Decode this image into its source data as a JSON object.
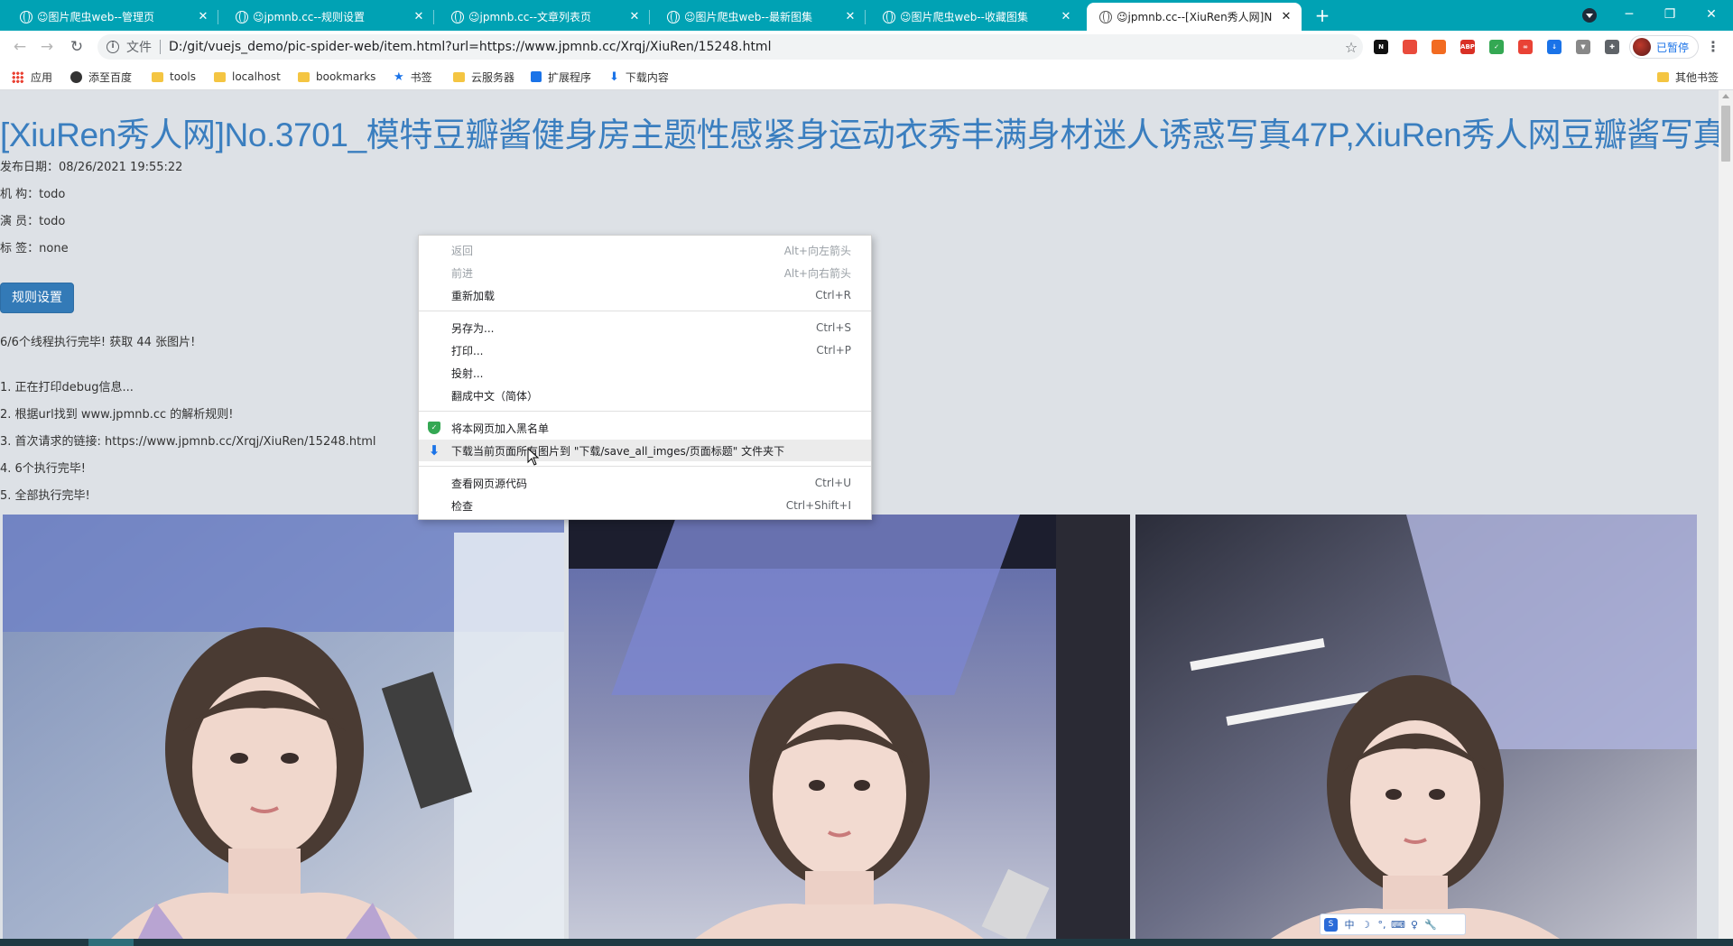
{
  "browser": {
    "tabs": [
      {
        "title": "😉图片爬虫web--管理页",
        "active": false
      },
      {
        "title": "😉jpmnb.cc--规则设置",
        "active": false
      },
      {
        "title": "😉jpmnb.cc--文章列表页",
        "active": false
      },
      {
        "title": "😉图片爬虫web--最新图集",
        "active": false
      },
      {
        "title": "😉图片爬虫web--收藏图集",
        "active": false
      },
      {
        "title": "😉jpmnb.cc--[XiuRen秀人网]N",
        "active": true
      }
    ],
    "new_tab_label": "+",
    "window_controls": {
      "minimize": "─",
      "restore": "❐",
      "close": "✕"
    },
    "address": {
      "security_label": "文件",
      "url": "D:/git/vuejs_demo/pic-spider-web/item.html?url=https://www.jpmnb.cc/Xrqj/XiuRen/15248.html"
    },
    "profile_label": "已暂停",
    "extensions": [
      {
        "name": "notion-icon",
        "color": "#111111",
        "text": "N"
      },
      {
        "name": "screenshot-icon",
        "color": "#e94b3c",
        "text": ""
      },
      {
        "name": "ext-orange-icon",
        "color": "#f26b21",
        "text": ""
      },
      {
        "name": "adblock-icon",
        "color": "#d93025",
        "text": "ABP"
      },
      {
        "name": "shield-ext-icon",
        "color": "#34a853",
        "text": "✓"
      },
      {
        "name": "ext-red-icon",
        "color": "#e94235",
        "text": "∞"
      },
      {
        "name": "download-ext-icon",
        "color": "#1a73e8",
        "text": "↓"
      },
      {
        "name": "ext-gray-icon",
        "color": "#888888",
        "text": "▼"
      },
      {
        "name": "extensions-puzzle-icon",
        "color": "#5f6368",
        "text": "✚"
      }
    ],
    "bookmarks": [
      {
        "label": "应用",
        "icon": "apps-grid-icon"
      },
      {
        "label": "添至百度",
        "icon": "globe-icon"
      },
      {
        "label": "tools",
        "icon": "folder-icon"
      },
      {
        "label": "localhost",
        "icon": "folder-icon"
      },
      {
        "label": "bookmarks",
        "icon": "folder-icon"
      },
      {
        "label": "书签",
        "icon": "star-icon"
      },
      {
        "label": "云服务器",
        "icon": "folder-icon"
      },
      {
        "label": "扩展程序",
        "icon": "puzzle-icon"
      },
      {
        "label": "下载内容",
        "icon": "download-icon"
      }
    ],
    "other_bookmarks": "其他书签"
  },
  "page": {
    "title": "[XiuRen秀人网]No.3701_模特豆瓣酱健身房主题性感紧身运动衣秀丰满身材迷人诱惑写真47P,XiuRen秀人网豆瓣酱写真",
    "publish_date": "发布日期：08/26/2021 19:55:22",
    "org": "机 构：todo",
    "actor": "演 员：todo",
    "tags": "标 签：none",
    "rule_button": "规则设置",
    "status": "6/6个线程执行完毕!   获取 44 张图片!",
    "log": [
      "1. 正在打印debug信息...",
      "2. 根据url找到 www.jpmnb.cc 的解析规则!",
      "3. 首次请求的链接: https://www.jpmnb.cc/Xrqj/XiuRen/15248.html",
      "4. 6个执行完毕!",
      "5. 全部执行完毕!"
    ],
    "photos": [
      "photo-1",
      "photo-2",
      "photo-3"
    ]
  },
  "context_menu": {
    "items": [
      {
        "label": "返回",
        "shortcut": "Alt+向左箭头",
        "disabled": true
      },
      {
        "label": "前进",
        "shortcut": "Alt+向右箭头",
        "disabled": true
      },
      {
        "label": "重新加载",
        "shortcut": "Ctrl+R",
        "disabled": false
      },
      {
        "label": "另存为...",
        "shortcut": "Ctrl+S",
        "disabled": false
      },
      {
        "label": "打印...",
        "shortcut": "Ctrl+P",
        "disabled": false
      },
      {
        "label": "投射...",
        "shortcut": "",
        "disabled": false
      },
      {
        "label": "翻成中文（简体）",
        "shortcut": "",
        "disabled": false
      },
      {
        "label": "将本网页加入黑名单",
        "shortcut": "",
        "icon": "shield-icon"
      },
      {
        "label": "下载当前页面所有图片到 \"下载/save_all_imges/页面标题\" 文件夹下",
        "shortcut": "",
        "icon": "download-arrow-icon",
        "hover": true
      },
      {
        "label": "查看网页源代码",
        "shortcut": "Ctrl+U",
        "disabled": false
      },
      {
        "label": "检查",
        "shortcut": "Ctrl+Shift+I",
        "disabled": false
      }
    ]
  },
  "ime": {
    "labels": [
      "中",
      "☽",
      "°,",
      "⌨",
      "♀",
      "🔧"
    ]
  },
  "colors": {
    "tabstrip": "#00a2b4",
    "link_blue": "#3a7ebf",
    "button_blue": "#337ab7",
    "page_bg": "#dde1e6"
  }
}
